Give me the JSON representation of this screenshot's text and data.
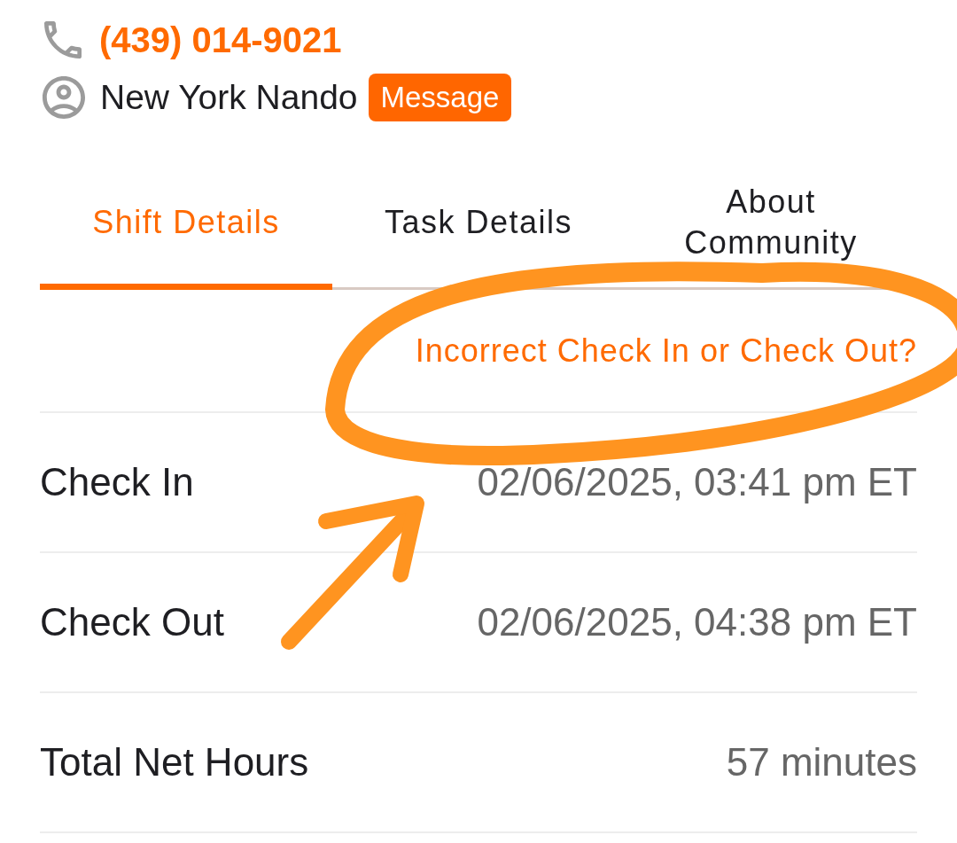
{
  "contact": {
    "phone": "(439) 014-9021",
    "name": "New York Nando",
    "message_button": "Message"
  },
  "tabs": [
    {
      "label": "Shift Details",
      "selected": true
    },
    {
      "label": "Task Details",
      "selected": false
    },
    {
      "label": "About Community",
      "selected": false
    }
  ],
  "shift_details": {
    "link": "Incorrect Check In or Check Out?",
    "rows": [
      {
        "label": "Check In",
        "value": "02/06/2025, 03:41 pm ET"
      },
      {
        "label": "Check Out",
        "value": "02/06/2025, 04:38 pm ET"
      },
      {
        "label": "Total Net Hours",
        "value": "57 minutes"
      }
    ]
  },
  "annotations": [
    {
      "kind": "ellipse"
    },
    {
      "kind": "arrow"
    }
  ]
}
